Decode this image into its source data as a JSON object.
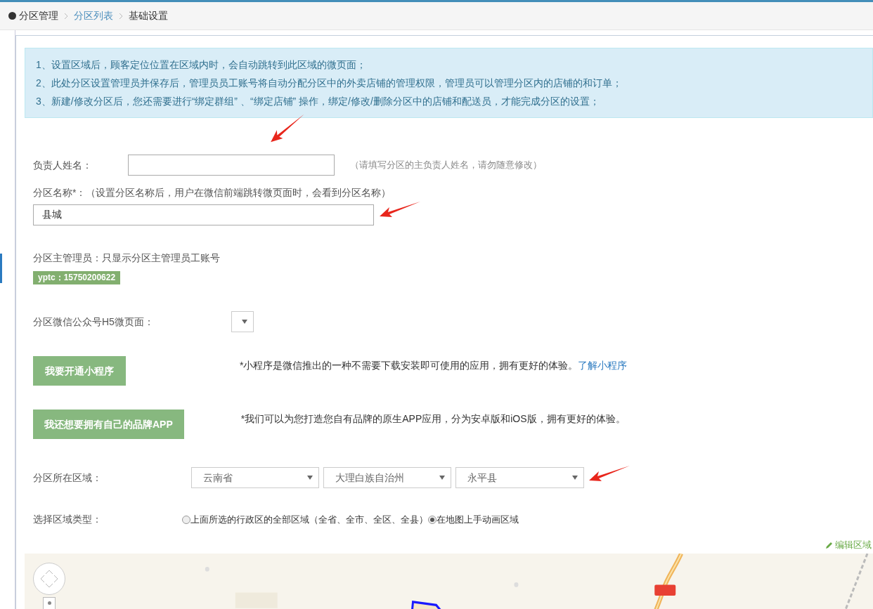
{
  "breadcrumb": [
    {
      "label": "分区管理",
      "kind": "root"
    },
    {
      "label": "分区列表",
      "kind": "link"
    },
    {
      "label": "基础设置",
      "kind": "current"
    }
  ],
  "notices": [
    "1、设置区域后，顾客定位位置在区域内时，会自动跳转到此区域的微页面；",
    "2、此处分区设置管理员并保存后，管理员员工账号将自动分配分区中的外卖店铺的管理权限，管理员可以管理分区内的店铺的和订单；",
    "3、新建/修改分区后，您还需要进行“绑定群组” 、“绑定店铺” 操作，绑定/修改/删除分区中的店铺和配送员，才能完成分区的设置；"
  ],
  "owner": {
    "label": "负责人姓名：",
    "hint": "（请填写分区的主负责人姓名，请勿随意修改）"
  },
  "area_name": {
    "label": "分区名称*：（设置分区名称后，用户在微信前端跳转微页面时，会看到分区名称）",
    "value": "县城"
  },
  "manager": {
    "label": "分区主管理员：只显示分区主管理员工账号",
    "badge": "yptc：15750200622"
  },
  "h5_page": {
    "label": "分区微信公众号H5微页面："
  },
  "promos": [
    {
      "button": "我要开通小程序",
      "text": "*小程序是微信推出的一种不需要下载安装即可使用的应用，拥有更好的体验。",
      "link": "了解小程序"
    },
    {
      "button": "我还想要拥有自己的品牌APP",
      "text": "*我们可以为您打造您自有品牌的原生APP应用，分为安卓版和iOS版，拥有更好的体验。"
    }
  ],
  "region": {
    "label": "分区所在区域：",
    "selects": [
      "云南省",
      "大理白族自治州",
      "永平县"
    ]
  },
  "region_type": {
    "label": "选择区域类型：",
    "options": [
      {
        "label": "上面所选的行政区的全部区域（全省、全市、全区、全县）",
        "selected": false
      },
      {
        "label": "在地图上手动画区域",
        "selected": true
      }
    ]
  },
  "edit_region": "编辑区域"
}
